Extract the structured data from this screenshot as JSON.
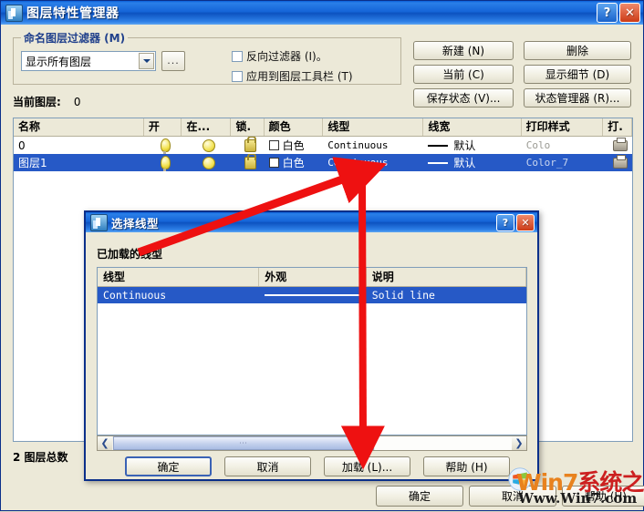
{
  "main_dialog": {
    "title": "图层特性管理器",
    "titlebar_buttons": [
      {
        "name": "help",
        "glyph": "?"
      },
      {
        "name": "close",
        "glyph": "✕"
      }
    ],
    "filter_group": {
      "legend": "命名图层过滤器 (M)",
      "combo_value": "显示所有图层",
      "ellipsis_label": "...",
      "checkboxes": [
        {
          "label": "反向过滤器 (I)。",
          "checked": false
        },
        {
          "label": "应用到图层工具栏 (T)",
          "checked": false
        }
      ]
    },
    "current_layer_label": "当前图层:",
    "current_layer_value": "0",
    "action_buttons": [
      {
        "label": "新建 (N)"
      },
      {
        "label": "删除"
      },
      {
        "label": "当前 (C)"
      },
      {
        "label": "显示细节 (D)"
      },
      {
        "label": "保存状态 (V)..."
      },
      {
        "label": "状态管理器 (R)..."
      }
    ],
    "layer_list": {
      "columns": [
        "名称",
        "开",
        "在...",
        "锁.",
        "颜色",
        "线型",
        "线宽",
        "打印样式",
        "打."
      ],
      "rows": [
        {
          "name": "0",
          "on": "bulb-icon",
          "freeze": "sun-icon",
          "lock": "lock-icon",
          "color": "白色",
          "linetype": "Continuous",
          "lineweight": "默认",
          "plotstyle": "Colo",
          "plot": "printer-icon",
          "selected": false
        },
        {
          "name": "图层1",
          "on": "bulb-icon",
          "freeze": "sun-icon",
          "lock": "lock-icon",
          "color": "白色",
          "linetype": "Continuous",
          "lineweight": "默认",
          "plotstyle": "Color_7",
          "plot": "printer-icon",
          "selected": true
        }
      ]
    },
    "status_text": "2 图层总数",
    "bottom_buttons": [
      {
        "label": "确定"
      },
      {
        "label": "取消"
      },
      {
        "label": "帮助 (H)"
      }
    ]
  },
  "linetype_dialog": {
    "title": "选择线型",
    "titlebar_buttons": [
      {
        "name": "help",
        "glyph": "?"
      },
      {
        "name": "close",
        "glyph": "✕"
      }
    ],
    "section_label": "已加载的线型",
    "list": {
      "columns": [
        "线型",
        "外观",
        "说明"
      ],
      "rows": [
        {
          "linetype": "Continuous",
          "appearance": "solid-line",
          "description": "Solid line",
          "selected": true
        }
      ]
    },
    "scrollbar": {
      "left_glyph": "❮",
      "right_glyph": "❯",
      "thumb_grip": "⋯"
    },
    "buttons": [
      {
        "label": "确定"
      },
      {
        "label": "取消"
      },
      {
        "label": "加载 (L)..."
      },
      {
        "label": "帮助 (H)"
      }
    ]
  },
  "annotations": {
    "arrow_color": "#ee1111",
    "arrow_1_target": "Continuous 线型单元格",
    "arrow_2_target": "加载 (L)... 按钮"
  },
  "watermark": {
    "brand_win": "Win",
    "brand_seven": "7",
    "brand_cn": "系统之家",
    "url": "Www.Win7.com"
  }
}
